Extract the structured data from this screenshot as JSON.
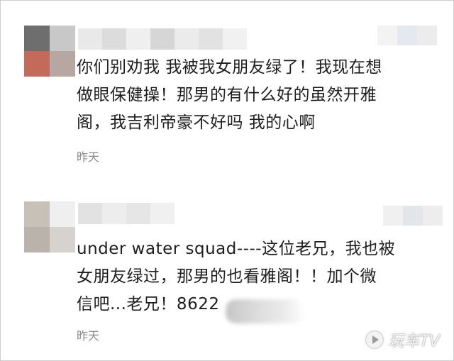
{
  "comments": [
    {
      "lines": [
        "你们别劝我 我被我女朋友绿了！我现在想",
        "做眼保健操！那男的有什么好的虽然开雅",
        "阁，我吉利帝豪不好吗 我的心啊"
      ],
      "time": "昨天",
      "avatar_colors": [
        "#6e6e6e",
        "#c8c8c8",
        "#c46a5a",
        "#b7a7a2"
      ],
      "name_blur_colors": [
        "#e9e9e9",
        "#dcdcdc",
        "#efefef",
        "#d6d6d6",
        "#ebebeb",
        "#e2e2e2",
        "#f1f1f1"
      ],
      "right_blur_colors": [
        "#f3f3f3",
        "#e3e9ee",
        "#ececec"
      ]
    },
    {
      "lines": [
        "under water squad----这位老兄，我也被",
        "女朋友绿过，那男的也看雅阁！！加个微",
        "信吧...老兄！8622"
      ],
      "time": "昨天",
      "avatar_colors": [
        "#c8c1b8",
        "#efefef",
        "#b9b3ac",
        "#d6d2cd"
      ],
      "name_blur_colors": [
        "#e2e2e2",
        "#ededed",
        "#e6e6e6",
        "#f0f0f0"
      ],
      "right_blur_colors": [
        "#f0f0f0",
        "#e2e6ea",
        "#ededed"
      ]
    }
  ],
  "watermark": {
    "icon": "play-logo-icon",
    "text": "玩车TV"
  }
}
